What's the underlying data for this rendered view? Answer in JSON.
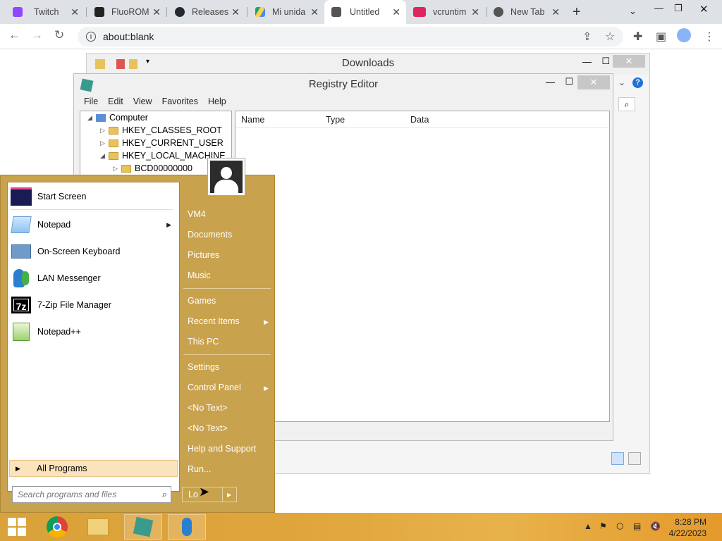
{
  "browser": {
    "tabs": [
      {
        "label": "Twitch",
        "color": "#9146ff"
      },
      {
        "label": "FluoROM",
        "color": "#222222"
      },
      {
        "label": "Releases",
        "color": "#24292f"
      },
      {
        "label": "Mi unida",
        "color": "#1fa463"
      },
      {
        "label": "Untitled",
        "color": "#555555",
        "active": true
      },
      {
        "label": "vcruntim",
        "color": "#e0245e"
      },
      {
        "label": "New Tab",
        "color": "#555555"
      }
    ],
    "address": "about:blank"
  },
  "downloads": {
    "title": "Downloads"
  },
  "regedit": {
    "title": "Registry Editor",
    "menu": [
      "File",
      "Edit",
      "View",
      "Favorites",
      "Help"
    ],
    "tree": {
      "root": "Computer",
      "items": [
        "HKEY_CLASSES_ROOT",
        "HKEY_CURRENT_USER",
        "HKEY_LOCAL_MACHINE",
        "BCD00000000"
      ]
    },
    "columns": [
      "Name",
      "Type",
      "Data"
    ]
  },
  "startmenu": {
    "pinned": [
      {
        "label": "Start Screen",
        "icon": "start-screen-icon"
      },
      {
        "label": "Notepad",
        "icon": "notepad-icon",
        "submenu": true
      },
      {
        "label": "On-Screen Keyboard",
        "icon": "keyboard-icon"
      },
      {
        "label": "LAN Messenger",
        "icon": "messenger-icon"
      },
      {
        "label": "7-Zip File Manager",
        "icon": "7zip-icon"
      },
      {
        "label": "Notepad++",
        "icon": "notepadpp-icon"
      }
    ],
    "all_programs": "All Programs",
    "search_placeholder": "Search programs and files",
    "right": {
      "user": "VM4",
      "documents": "Documents",
      "pictures": "Pictures",
      "music": "Music",
      "games": "Games",
      "recent": "Recent Items",
      "thispc": "This PC",
      "settings": "Settings",
      "controlpanel": "Control Panel",
      "notext1": "<No Text>",
      "notext2": "<No Text>",
      "help": "Help and Support",
      "run": "Run...",
      "logoff": "Lo"
    }
  },
  "taskbar": {
    "time": "8:28 PM",
    "date": "4/22/2023"
  },
  "colors": {
    "start_bg": "#c9a24e",
    "taskbar": "#e0a43c"
  }
}
